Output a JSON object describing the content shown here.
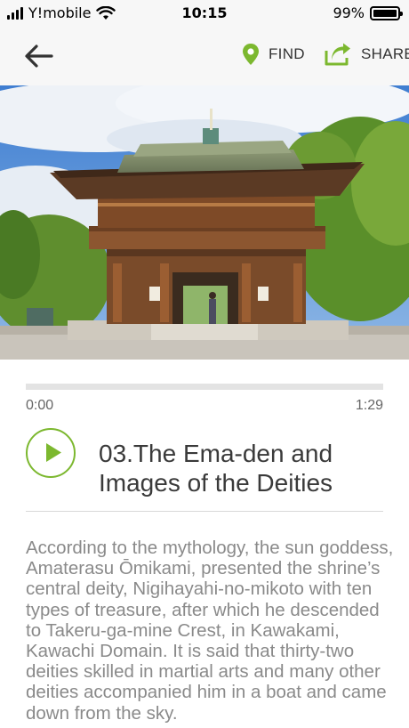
{
  "status_bar": {
    "carrier": "Y!mobile",
    "time": "10:15",
    "battery_percent": "99%",
    "battery_level": 0.99
  },
  "nav": {
    "back_icon": "arrow-left-icon",
    "find_label": "FIND",
    "find_icon": "map-pin-icon",
    "share_label": "SHARE",
    "share_icon": "share-icon",
    "accent_color": "#7cb82f"
  },
  "hero": {
    "subject": "shrine-gate-photo"
  },
  "player": {
    "progress": 0.0,
    "current_time": "0:00",
    "duration": "1:29",
    "play_icon": "play-icon"
  },
  "track": {
    "title": "03.The Ema-den and Images of the Deities"
  },
  "description": "According to the mythology, the sun goddess, Amaterasu Ōmikami, presented the shrine’s central deity, Nigihayahi-no-mikoto with ten types of treasure, after which he descended to Takeru-ga-mine Crest, in Kawakami, Kawachi Domain. It is said that thirty-two deities skilled in martial arts and many other deities accompanied him in a boat and came down from the sky."
}
